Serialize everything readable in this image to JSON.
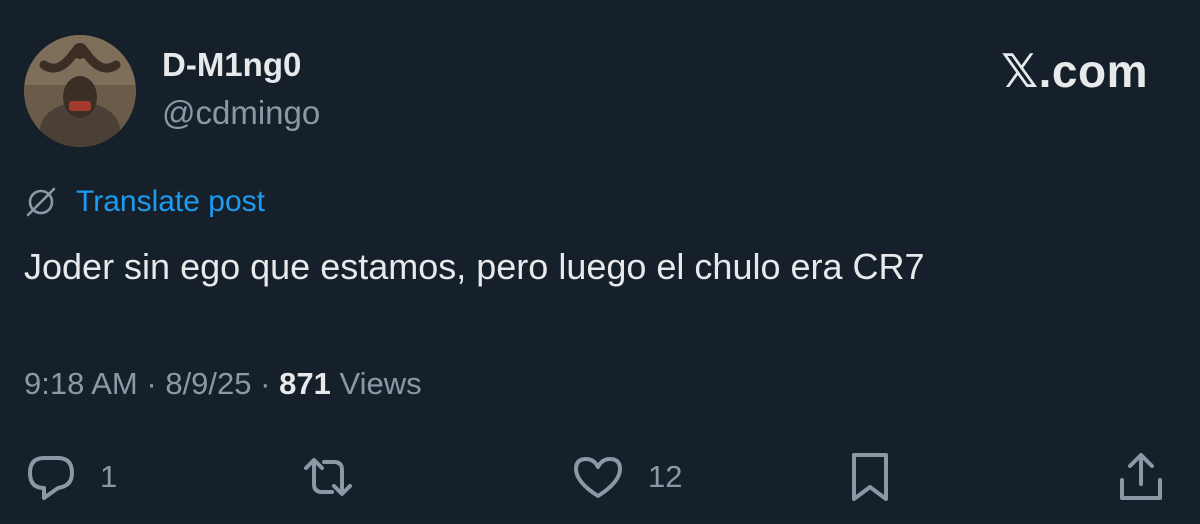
{
  "author": {
    "name": "D-M1ng0",
    "handle": "@cdmingo"
  },
  "brand": {
    "label": "𝕏.com"
  },
  "translate": {
    "label": "Translate post",
    "icon": "globe-slash-icon"
  },
  "post": {
    "text": "Joder sin ego que estamos, pero luego el chulo era CR7"
  },
  "meta": {
    "time": "9:18 AM",
    "separator": "·",
    "date": "8/9/25",
    "views_count": "871",
    "views_label": "Views"
  },
  "actions": {
    "reply": {
      "icon": "reply-icon",
      "count": "1"
    },
    "repost": {
      "icon": "repost-icon"
    },
    "like": {
      "icon": "heart-icon",
      "count": "12"
    },
    "bookmark": {
      "icon": "bookmark-icon"
    },
    "share": {
      "icon": "share-icon"
    }
  },
  "colors": {
    "background": "#15202b",
    "text_primary": "#e7e9ea",
    "text_secondary": "#8b98a5",
    "accent": "#1d9bf0"
  }
}
